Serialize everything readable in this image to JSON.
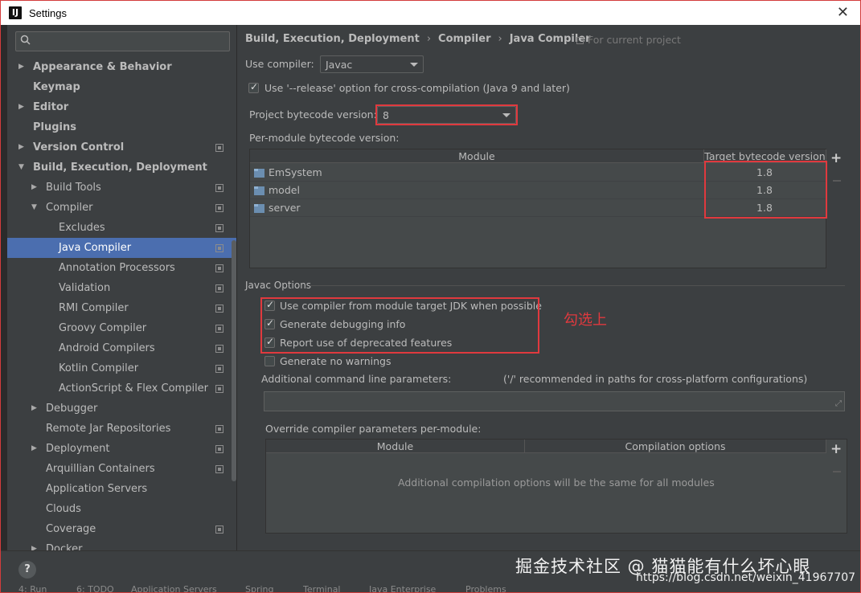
{
  "window": {
    "title": "Settings",
    "app_icon_letter": "IJ"
  },
  "search": {
    "placeholder": ""
  },
  "sidebar": {
    "items": [
      {
        "label": "Appearance & Behavior",
        "bold": true,
        "arrow": "▶",
        "level": 0,
        "proj": false
      },
      {
        "label": "Keymap",
        "bold": true,
        "arrow": "",
        "level": 0,
        "proj": false
      },
      {
        "label": "Editor",
        "bold": true,
        "arrow": "▶",
        "level": 0,
        "proj": false
      },
      {
        "label": "Plugins",
        "bold": true,
        "arrow": "",
        "level": 0,
        "proj": false
      },
      {
        "label": "Version Control",
        "bold": true,
        "arrow": "▶",
        "level": 0,
        "proj": true
      },
      {
        "label": "Build, Execution, Deployment",
        "bold": true,
        "arrow": "▼",
        "level": 0,
        "proj": false
      },
      {
        "label": "Build Tools",
        "bold": false,
        "arrow": "▶",
        "level": 1,
        "proj": true
      },
      {
        "label": "Compiler",
        "bold": false,
        "arrow": "▼",
        "level": 1,
        "proj": true
      },
      {
        "label": "Excludes",
        "bold": false,
        "arrow": "",
        "level": 2,
        "proj": true
      },
      {
        "label": "Java Compiler",
        "bold": false,
        "arrow": "",
        "level": 2,
        "proj": true,
        "selected": true
      },
      {
        "label": "Annotation Processors",
        "bold": false,
        "arrow": "",
        "level": 2,
        "proj": true
      },
      {
        "label": "Validation",
        "bold": false,
        "arrow": "",
        "level": 2,
        "proj": true
      },
      {
        "label": "RMI Compiler",
        "bold": false,
        "arrow": "",
        "level": 2,
        "proj": true
      },
      {
        "label": "Groovy Compiler",
        "bold": false,
        "arrow": "",
        "level": 2,
        "proj": true
      },
      {
        "label": "Android Compilers",
        "bold": false,
        "arrow": "",
        "level": 2,
        "proj": true
      },
      {
        "label": "Kotlin Compiler",
        "bold": false,
        "arrow": "",
        "level": 2,
        "proj": true
      },
      {
        "label": "ActionScript & Flex Compiler",
        "bold": false,
        "arrow": "",
        "level": 2,
        "proj": true
      },
      {
        "label": "Debugger",
        "bold": false,
        "arrow": "▶",
        "level": 1,
        "proj": false
      },
      {
        "label": "Remote Jar Repositories",
        "bold": false,
        "arrow": "",
        "level": 1,
        "proj": true
      },
      {
        "label": "Deployment",
        "bold": false,
        "arrow": "▶",
        "level": 1,
        "proj": true
      },
      {
        "label": "Arquillian Containers",
        "bold": false,
        "arrow": "",
        "level": 1,
        "proj": true
      },
      {
        "label": "Application Servers",
        "bold": false,
        "arrow": "",
        "level": 1,
        "proj": false
      },
      {
        "label": "Clouds",
        "bold": false,
        "arrow": "",
        "level": 1,
        "proj": false
      },
      {
        "label": "Coverage",
        "bold": false,
        "arrow": "",
        "level": 1,
        "proj": true
      },
      {
        "label": "Docker",
        "bold": false,
        "arrow": "▶",
        "level": 1,
        "proj": false
      }
    ]
  },
  "breadcrumb": {
    "part1": "Build, Execution, Deployment",
    "sep": "›",
    "part2": "Compiler",
    "part3": "Java Compiler",
    "scope": "For current project"
  },
  "compiler": {
    "use_compiler_label": "Use compiler:",
    "use_compiler_value": "Javac",
    "release_option_label": "Use '--release' option for cross-compilation (Java 9 and later)",
    "release_option_checked": true,
    "project_bytecode_label": "Project bytecode version:",
    "project_bytecode_value": "8",
    "per_module_label": "Per-module bytecode version:"
  },
  "module_table": {
    "col_module": "Module",
    "col_target": "Target bytecode version",
    "rows": [
      {
        "name": "EmSystem",
        "target": "1.8"
      },
      {
        "name": "model",
        "target": "1.8"
      },
      {
        "name": "server",
        "target": "1.8"
      }
    ],
    "add": "+"
  },
  "javac_options": {
    "title": "Javac Options",
    "opt1": "Use compiler from module target JDK when possible",
    "opt1_checked": true,
    "opt2": "Generate debugging info",
    "opt2_checked": true,
    "opt3": "Report use of deprecated features",
    "opt3_checked": true,
    "opt4": "Generate no warnings",
    "opt4_checked": false,
    "cmdline_label": "Additional command line parameters:",
    "cmdline_hint": "('/' recommended in paths for cross-platform configurations)",
    "cmdline_value": "",
    "resize": "⤢"
  },
  "annotation": {
    "text": "勾选上",
    "color": "#e0393e"
  },
  "override_table": {
    "label": "Override compiler parameters per-module:",
    "col_module": "Module",
    "col_options": "Compilation options",
    "empty": "Additional compilation options will be the same for all modules",
    "add": "+"
  },
  "bottom": {
    "help": "?",
    "watermark": "掘金技术社区 @ 猫猫能有什么坏心眼",
    "watermark_url": "https://blog.csdn.net/weixin_41967707",
    "tools": [
      "4: Run",
      "6: TODO",
      "Application Servers",
      "Spring",
      "Terminal",
      "Java Enterprise",
      "Problems"
    ]
  },
  "colors": {
    "selection": "#4b6eaf",
    "highlight_box": "#e0393e",
    "background": "#3c3f41"
  }
}
